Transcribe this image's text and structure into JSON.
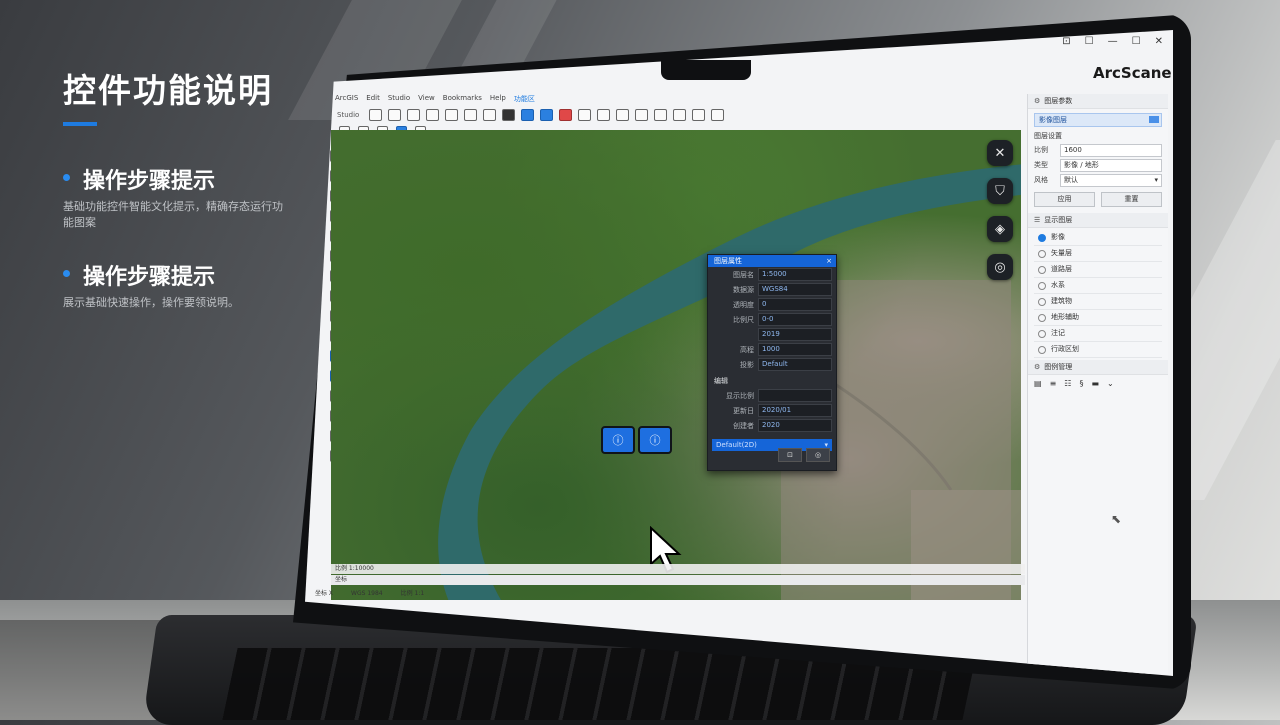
{
  "slide": {
    "title": "控件功能说明",
    "steps": [
      {
        "heading": "操作步骤提示",
        "description": "基础功能控件智能文化提示，精确存态运行功能图案"
      },
      {
        "heading": "操作步骤提示",
        "description": "展示基础快速操作，操作要领说明。"
      }
    ]
  },
  "app": {
    "brand": "ArcScane",
    "window_controls": [
      "⊡",
      "☐",
      "—",
      "☐",
      "✕"
    ],
    "menu": [
      "ArcGIS",
      "Edit",
      "Studio",
      "View",
      "Bookmarks",
      "Help",
      "功能区"
    ],
    "active_menu_index": 6,
    "toolbar_label": "Studio"
  },
  "map": {
    "side_buttons": [
      {
        "icon": "close-icon",
        "glyph": "✕"
      },
      {
        "icon": "shield-icon",
        "glyph": "⛉"
      },
      {
        "icon": "layers-icon",
        "glyph": "◈"
      },
      {
        "icon": "measure-icon",
        "glyph": "◎"
      }
    ],
    "markers": [
      {
        "icon": "pin-icon",
        "glyph": "ⓘ"
      },
      {
        "icon": "pin-icon",
        "glyph": "ⓘ"
      }
    ],
    "bottom_tools": [
      {
        "icon": "globe-icon",
        "glyph": "⊕",
        "active": false
      },
      {
        "icon": "document-icon",
        "glyph": "❐",
        "active": false
      },
      {
        "icon": "refresh-icon",
        "glyph": "↻",
        "active": false
      },
      {
        "icon": "square-icon",
        "glyph": "■",
        "active": false
      },
      {
        "icon": "door-icon",
        "glyph": "▯",
        "active": false
      },
      {
        "icon": "target-icon",
        "glyph": "◉",
        "active": true
      }
    ],
    "status_line1": "比例 1:10000",
    "status_line2": "坐标",
    "statusbar": [
      "坐标 X",
      "WGS 1984",
      "比例 1:1"
    ]
  },
  "dialog": {
    "title": "图层属性",
    "close": "×",
    "fields": [
      {
        "label": "图层名",
        "value": "1:5000"
      },
      {
        "label": "数据源",
        "value": "WGS84"
      },
      {
        "label": "透明度",
        "value": "0"
      },
      {
        "label": "比例尺",
        "value": "0-0"
      },
      {
        "label": "",
        "value": "2019"
      },
      {
        "label": "高程",
        "value": "1000"
      },
      {
        "label": "投影",
        "value": "Default"
      }
    ],
    "section_label": "编辑",
    "fields2": [
      {
        "label": "显示比例",
        "value": ""
      },
      {
        "label": "更新日",
        "value": "2020/01"
      },
      {
        "label": "创建者",
        "value": "2020"
      }
    ],
    "select_value": "Default(2D)",
    "buttons": [
      "⊡",
      "◎"
    ]
  },
  "right_panel": {
    "section1_title": "图层参数",
    "selected_layer": "影像图层",
    "group_label": "图层设置",
    "fields": [
      {
        "label": "比例",
        "value": "1600"
      },
      {
        "label": "类型",
        "value": "影像 / 地形"
      },
      {
        "label": "风格",
        "value": "默认"
      }
    ],
    "buttons": [
      "应用",
      "重置"
    ],
    "section2_title": "显示图层",
    "layers": [
      {
        "label": "影像",
        "on": true
      },
      {
        "label": "矢量层",
        "on": false
      },
      {
        "label": "道路层",
        "on": false
      },
      {
        "label": "水系",
        "on": false
      },
      {
        "label": "建筑物",
        "on": false
      },
      {
        "label": "地形辅助",
        "on": false
      },
      {
        "label": "注记",
        "on": false
      },
      {
        "label": "行政区划",
        "on": false
      }
    ],
    "section3_title": "图例管理",
    "tools": [
      "▤",
      "≡",
      "☷",
      "§",
      "▬",
      "⌄"
    ]
  },
  "colors": {
    "accent": "#1e7be0",
    "dialog_title": "#1565d8",
    "marker": "#1e6fe0"
  }
}
